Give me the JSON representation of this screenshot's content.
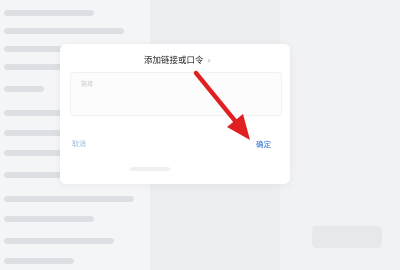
{
  "dialog": {
    "title": "添加链接或口令",
    "close_glyph": "›",
    "input_placeholder": "链接",
    "cancel_label": "取消",
    "confirm_label": "确定"
  },
  "annotation": {
    "arrow_color": "#e02020"
  },
  "colors": {
    "confirm": "#2f6fd6",
    "cancel": "#9fb6e0",
    "background": "#eceef1"
  }
}
